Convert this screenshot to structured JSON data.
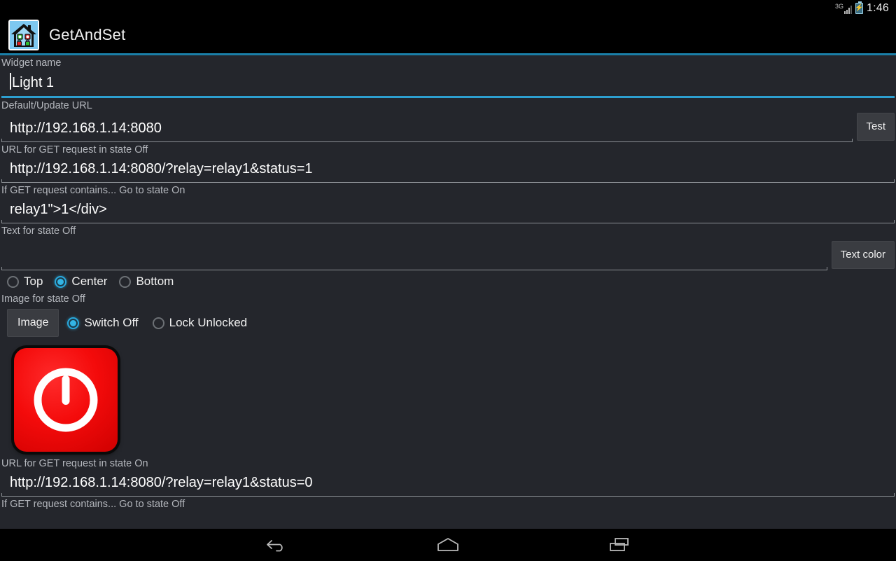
{
  "status_bar": {
    "network_type": "3G",
    "battery_icon": "battery-charging-icon",
    "signal_icon": "signal-bars-icon",
    "time": "1:46"
  },
  "action_bar": {
    "app_icon": "house-app-icon",
    "title": "GetAndSet",
    "accent_color": "#1a7fa8"
  },
  "form": {
    "widget_name": {
      "label": "Widget name",
      "value": "Light 1",
      "placeholder": "",
      "focused": true
    },
    "default_update_url": {
      "label": "Default/Update URL",
      "value": "http://192.168.1.14:8080",
      "placeholder": "",
      "button_label": "Test"
    },
    "url_get_state_off": {
      "label": "URL for GET request in state Off",
      "value": "http://192.168.1.14:8080/?relay=relay1&status=1",
      "placeholder": ""
    },
    "contains_state_on": {
      "label": "If GET request contains... Go to state On",
      "value": "relay1\">1</div>",
      "placeholder": ""
    },
    "text_state_off": {
      "label": "Text for state Off",
      "value": "",
      "placeholder": "",
      "button_label": "Text color"
    },
    "alignment": {
      "options": [
        {
          "label": "Top",
          "selected": false
        },
        {
          "label": "Center",
          "selected": true
        },
        {
          "label": "Bottom",
          "selected": false
        }
      ]
    },
    "image_state_off": {
      "label": "Image for state Off",
      "button_label": "Image",
      "options": [
        {
          "label": "Switch Off",
          "selected": true
        },
        {
          "label": "Lock Unlocked",
          "selected": false
        }
      ],
      "preview_icon": "power-button-red-icon",
      "preview_color": "#ef0f0f"
    },
    "url_get_state_on": {
      "label": "URL for GET request in state On",
      "value": "http://192.168.1.14:8080/?relay=relay1&status=0",
      "placeholder": ""
    },
    "contains_state_off": {
      "label": "If GET request contains... Go to state Off",
      "value": "",
      "placeholder": ""
    }
  },
  "nav_bar": {
    "back": "back-icon",
    "home": "home-icon",
    "recents": "recents-icon"
  },
  "colors": {
    "accent": "#33b5e5",
    "background": "#24262c",
    "bar": "#000000",
    "label_text": "#b4b7bd",
    "value_text": "#ffffff"
  }
}
